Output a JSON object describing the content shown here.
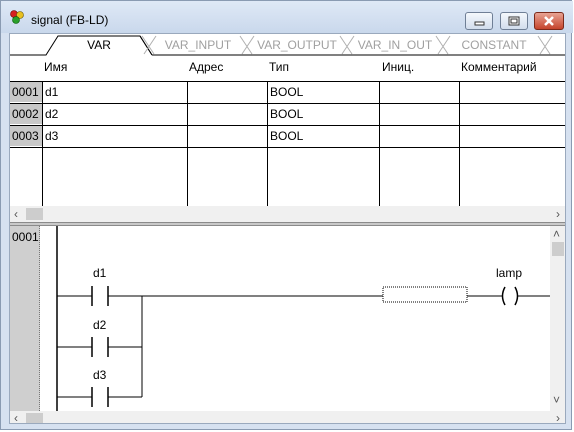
{
  "window": {
    "title": "signal (FB-LD)"
  },
  "tabs": [
    {
      "label": "VAR",
      "active": true
    },
    {
      "label": "VAR_INPUT",
      "active": false
    },
    {
      "label": "VAR_OUTPUT",
      "active": false
    },
    {
      "label": "VAR_IN_OUT",
      "active": false
    },
    {
      "label": "CONSTANT",
      "active": false
    }
  ],
  "table": {
    "headers": [
      "Имя",
      "Адрес",
      "Тип",
      "Иниц.",
      "Комментарий"
    ],
    "rows": [
      {
        "num": "0001",
        "name": "d1",
        "address": "",
        "type": "BOOL",
        "init": "",
        "comment": ""
      },
      {
        "num": "0002",
        "name": "d2",
        "address": "",
        "type": "BOOL",
        "init": "",
        "comment": ""
      },
      {
        "num": "0003",
        "name": "d3",
        "address": "",
        "type": "BOOL",
        "init": "",
        "comment": ""
      }
    ]
  },
  "ladder": {
    "network_number": "0001",
    "contacts": [
      "d1",
      "d2",
      "d3"
    ],
    "coil_label": "lamp",
    "coil_symbol": "( )"
  },
  "icons": {
    "app": "traffic-light-icon",
    "scroll_left": "‹",
    "scroll_right": "›",
    "scroll_up": "˄",
    "scroll_down": "˅"
  }
}
